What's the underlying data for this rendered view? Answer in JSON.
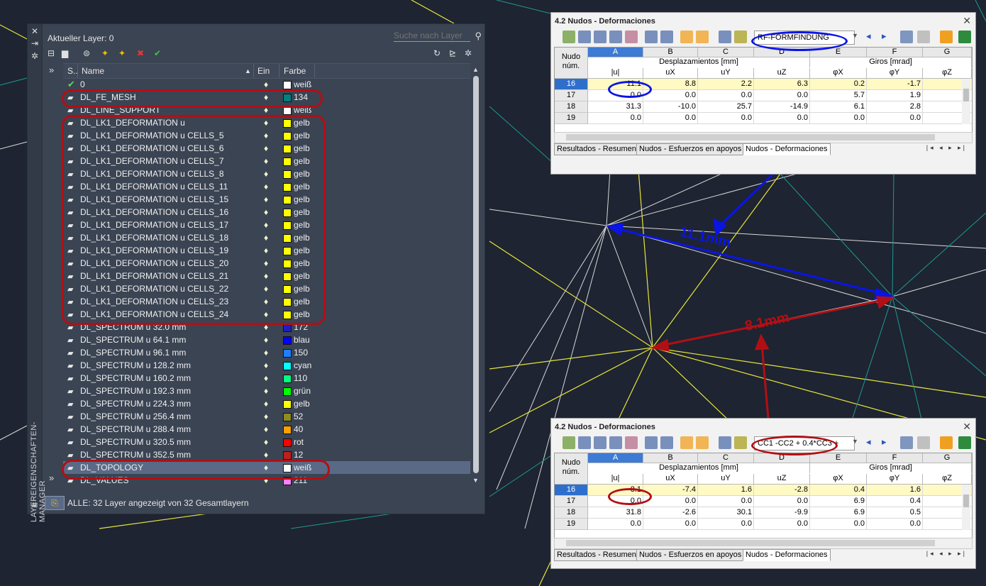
{
  "layer_manager": {
    "current_layer": "Aktueller Layer: 0",
    "search_placeholder": "Suche nach Layer",
    "vertical_title": "LAYEREIGENSCHAFTEN-MANAGER",
    "columns": {
      "status": "S..",
      "name": "Name",
      "on": "Ein",
      "color": "Farbe"
    },
    "layers": [
      {
        "name": "0",
        "color_name": "weiß",
        "hex": "#ffffff",
        "current": true
      },
      {
        "name": "DL_FE_MESH",
        "color_name": "134",
        "hex": "#007f7f"
      },
      {
        "name": "DL_LINE_SUPPORT",
        "color_name": "weiß",
        "hex": "#ffffff"
      },
      {
        "name": "DL_LK1_DEFORMATION u",
        "color_name": "gelb",
        "hex": "#ffff00"
      },
      {
        "name": "DL_LK1_DEFORMATION u CELLS_5",
        "color_name": "gelb",
        "hex": "#ffff00"
      },
      {
        "name": "DL_LK1_DEFORMATION u CELLS_6",
        "color_name": "gelb",
        "hex": "#ffff00"
      },
      {
        "name": "DL_LK1_DEFORMATION u CELLS_7",
        "color_name": "gelb",
        "hex": "#ffff00"
      },
      {
        "name": "DL_LK1_DEFORMATION u CELLS_8",
        "color_name": "gelb",
        "hex": "#ffff00"
      },
      {
        "name": "DL_LK1_DEFORMATION u CELLS_11",
        "color_name": "gelb",
        "hex": "#ffff00"
      },
      {
        "name": "DL_LK1_DEFORMATION u CELLS_15",
        "color_name": "gelb",
        "hex": "#ffff00"
      },
      {
        "name": "DL_LK1_DEFORMATION u CELLS_16",
        "color_name": "gelb",
        "hex": "#ffff00"
      },
      {
        "name": "DL_LK1_DEFORMATION u CELLS_17",
        "color_name": "gelb",
        "hex": "#ffff00"
      },
      {
        "name": "DL_LK1_DEFORMATION u CELLS_18",
        "color_name": "gelb",
        "hex": "#ffff00"
      },
      {
        "name": "DL_LK1_DEFORMATION u CELLS_19",
        "color_name": "gelb",
        "hex": "#ffff00"
      },
      {
        "name": "DL_LK1_DEFORMATION u CELLS_20",
        "color_name": "gelb",
        "hex": "#ffff00"
      },
      {
        "name": "DL_LK1_DEFORMATION u CELLS_21",
        "color_name": "gelb",
        "hex": "#ffff00"
      },
      {
        "name": "DL_LK1_DEFORMATION u CELLS_22",
        "color_name": "gelb",
        "hex": "#ffff00"
      },
      {
        "name": "DL_LK1_DEFORMATION u CELLS_23",
        "color_name": "gelb",
        "hex": "#ffff00"
      },
      {
        "name": "DL_LK1_DEFORMATION u CELLS_24",
        "color_name": "gelb",
        "hex": "#ffff00"
      },
      {
        "name": "DL_SPECTRUM u  32.0 mm",
        "color_name": "172",
        "hex": "#1f1fbf"
      },
      {
        "name": "DL_SPECTRUM u  64.1 mm",
        "color_name": "blau",
        "hex": "#0000ff"
      },
      {
        "name": "DL_SPECTRUM u  96.1 mm",
        "color_name": "150",
        "hex": "#1f7fff"
      },
      {
        "name": "DL_SPECTRUM u 128.2 mm",
        "color_name": "cyan",
        "hex": "#00ffff"
      },
      {
        "name": "DL_SPECTRUM u 160.2 mm",
        "color_name": "110",
        "hex": "#00ff7f"
      },
      {
        "name": "DL_SPECTRUM u 192.3 mm",
        "color_name": "grün",
        "hex": "#00ff00"
      },
      {
        "name": "DL_SPECTRUM u 224.3 mm",
        "color_name": "gelb",
        "hex": "#ffff00"
      },
      {
        "name": "DL_SPECTRUM u 256.4 mm",
        "color_name": "52",
        "hex": "#8c8c1f"
      },
      {
        "name": "DL_SPECTRUM u 288.4 mm",
        "color_name": "40",
        "hex": "#ff9f00"
      },
      {
        "name": "DL_SPECTRUM u 320.5 mm",
        "color_name": "rot",
        "hex": "#ff0000"
      },
      {
        "name": "DL_SPECTRUM u 352.5 mm",
        "color_name": "12",
        "hex": "#bf1f1f"
      },
      {
        "name": "DL_TOPOLOGY",
        "color_name": "weiß",
        "hex": "#ffffff",
        "selected": true
      },
      {
        "name": "DL_VALUES",
        "color_name": "211",
        "hex": "#ff7fff"
      }
    ],
    "status_text": "ALLE: 32 Layer angezeigt von 32 Gesamtlayern"
  },
  "dialogs": [
    {
      "title": "4.2 Nudos - Deformaciones",
      "combo": "RF-FORMFINDUNG",
      "col_letters": [
        "A",
        "B",
        "C",
        "D",
        "E",
        "F",
        "G"
      ],
      "row_header_label_1": "Nudo",
      "row_header_label_2": "núm.",
      "group_disp": "Desplazamientos [mm]",
      "group_rot": "Giros [mrad]",
      "sub_headers": [
        "|u|",
        "uX",
        "uY",
        "uZ",
        "φX",
        "φY",
        "φZ"
      ],
      "rows": [
        {
          "node": "16",
          "vals": [
            "11.1",
            "8.8",
            "2.2",
            "6.3",
            "0.2",
            "-1.7"
          ],
          "selected": true
        },
        {
          "node": "17",
          "vals": [
            "0.0",
            "0.0",
            "0.0",
            "0.0",
            "5.7",
            "1.9"
          ]
        },
        {
          "node": "18",
          "vals": [
            "31.3",
            "-10.0",
            "25.7",
            "-14.9",
            "6.1",
            "2.8"
          ]
        },
        {
          "node": "19",
          "vals": [
            "0.0",
            "0.0",
            "0.0",
            "0.0",
            "0.0",
            "0.0"
          ]
        }
      ],
      "tabs": [
        "Resultados - Resumen",
        "Nudos - Esfuerzos en apoyos",
        "Nudos - Deformaciones"
      ]
    },
    {
      "title": "4.2 Nudos - Deformaciones",
      "combo": "CC1 -CC2 + 0.4*CC3 +",
      "col_letters": [
        "A",
        "B",
        "C",
        "D",
        "E",
        "F",
        "G"
      ],
      "row_header_label_1": "Nudo",
      "row_header_label_2": "núm.",
      "group_disp": "Desplazamientos [mm]",
      "group_rot": "Giros [mrad]",
      "sub_headers": [
        "|u|",
        "uX",
        "uY",
        "uZ",
        "φX",
        "φY",
        "φZ"
      ],
      "rows": [
        {
          "node": "16",
          "vals": [
            "8.1",
            "-7.4",
            "1.6",
            "-2.8",
            "0.4",
            "1.6"
          ],
          "selected": true
        },
        {
          "node": "17",
          "vals": [
            "0.0",
            "0.0",
            "0.0",
            "0.0",
            "6.9",
            "0.4"
          ]
        },
        {
          "node": "18",
          "vals": [
            "31.8",
            "-2.6",
            "30.1",
            "-9.9",
            "6.9",
            "0.5"
          ]
        },
        {
          "node": "19",
          "vals": [
            "0.0",
            "0.0",
            "0.0",
            "0.0",
            "0.0",
            "0.0"
          ]
        }
      ],
      "tabs": [
        "Resultados - Resumen",
        "Nudos - Esfuerzos en apoyos",
        "Nudos - Deformaciones"
      ]
    }
  ],
  "annotations": {
    "blue_dim": "11.1mm",
    "red_dim": "8.1mm"
  },
  "colors": {
    "annotation_red": "#b20f14",
    "annotation_blue": "#0a14e6",
    "background": "#1e2431"
  }
}
